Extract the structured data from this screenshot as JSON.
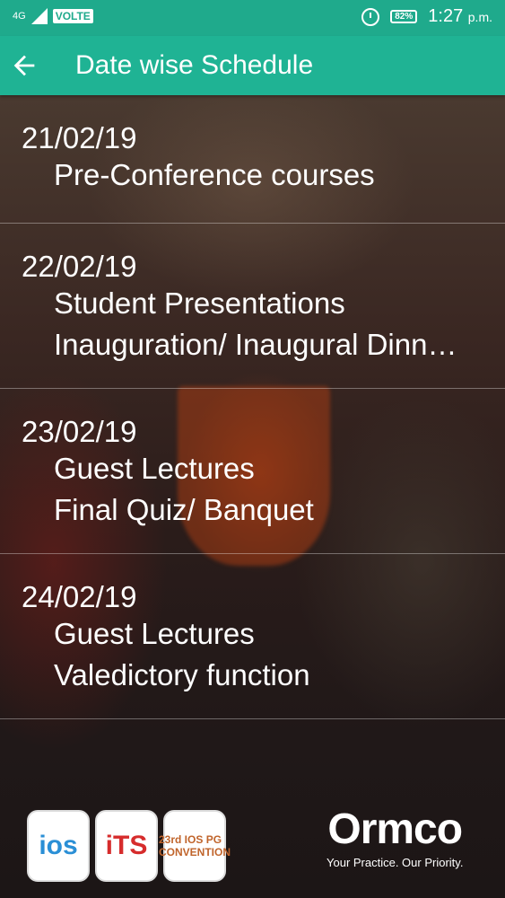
{
  "status": {
    "network": "4G",
    "volte": "VOLTE",
    "battery": "82%",
    "time": "1:27",
    "ampm": "p.m."
  },
  "appbar": {
    "title": "Date wise Schedule"
  },
  "schedule": [
    {
      "date": "21/02/19",
      "items": [
        "Pre-Conference courses"
      ]
    },
    {
      "date": "22/02/19",
      "items": [
        "Student Presentations",
        "Inauguration/ Inaugural Dinn…"
      ]
    },
    {
      "date": "23/02/19",
      "items": [
        "Guest Lectures",
        "Final Quiz/ Banquet"
      ]
    },
    {
      "date": "24/02/19",
      "items": [
        "Guest Lectures",
        "Valedictory function"
      ]
    }
  ],
  "footer": {
    "logo1": "ios",
    "logo2": "iTS",
    "logo3": "23rd IOS PG CONVENTION",
    "brand": "Ormco",
    "tagline": "Your Practice. Our Priority."
  },
  "colors": {
    "primary": "#1fb394",
    "statusbar": "#1faa8c"
  }
}
